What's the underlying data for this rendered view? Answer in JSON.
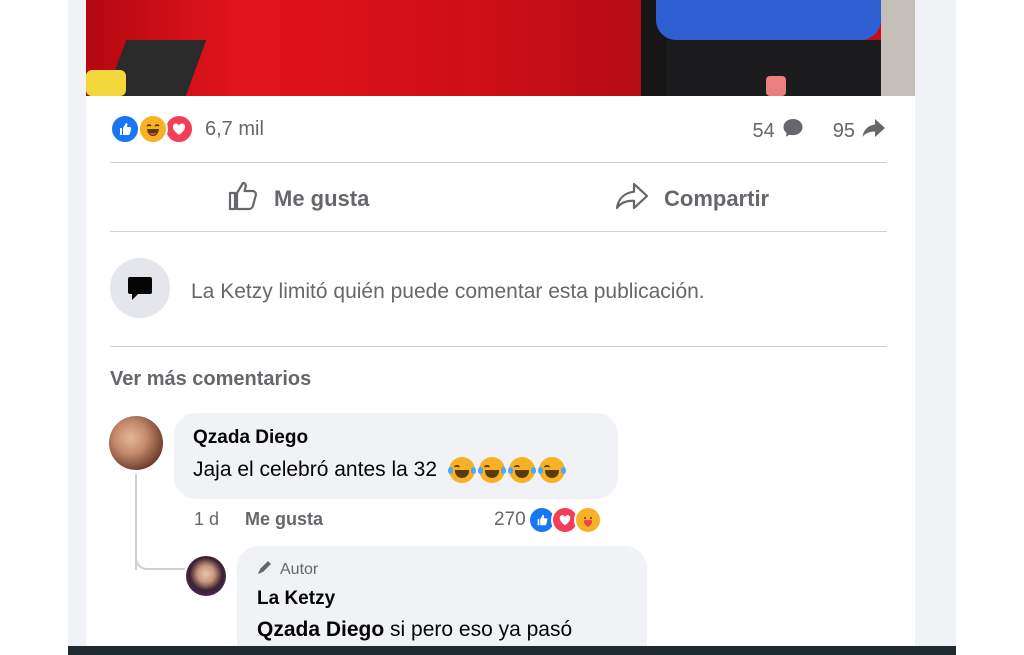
{
  "post": {
    "reaction_count": "6,7 mil",
    "reactions": [
      "like-icon",
      "haha-icon",
      "love-icon"
    ],
    "comments_count": "54",
    "shares_count": "95"
  },
  "actions": {
    "like_label": "Me gusta",
    "share_label": "Compartir"
  },
  "restriction": {
    "text": "La Ketzy limitó quién puede comentar esta publicación."
  },
  "comments_section": {
    "more_label": "Ver más comentarios"
  },
  "comment1": {
    "author": "Qzada Diego",
    "text": "Jaja el celebró antes la 32",
    "emoji": [
      "😂",
      "😂",
      "😂",
      "😂"
    ],
    "time": "1 d",
    "like_label": "Me gusta",
    "reaction_count": "270",
    "reactions": [
      "like-icon",
      "love-icon",
      "care-icon"
    ]
  },
  "reply1": {
    "badge": "Autor",
    "author": "La Ketzy",
    "mention": "Qzada Diego",
    "text": " si pero eso ya pasó"
  },
  "colors": {
    "like_blue": "#1877f2",
    "love_red": "#f33e58",
    "haha_yellow": "#f7b125",
    "secondary_text": "#65676b",
    "bubble_bg": "#f0f2f5"
  }
}
